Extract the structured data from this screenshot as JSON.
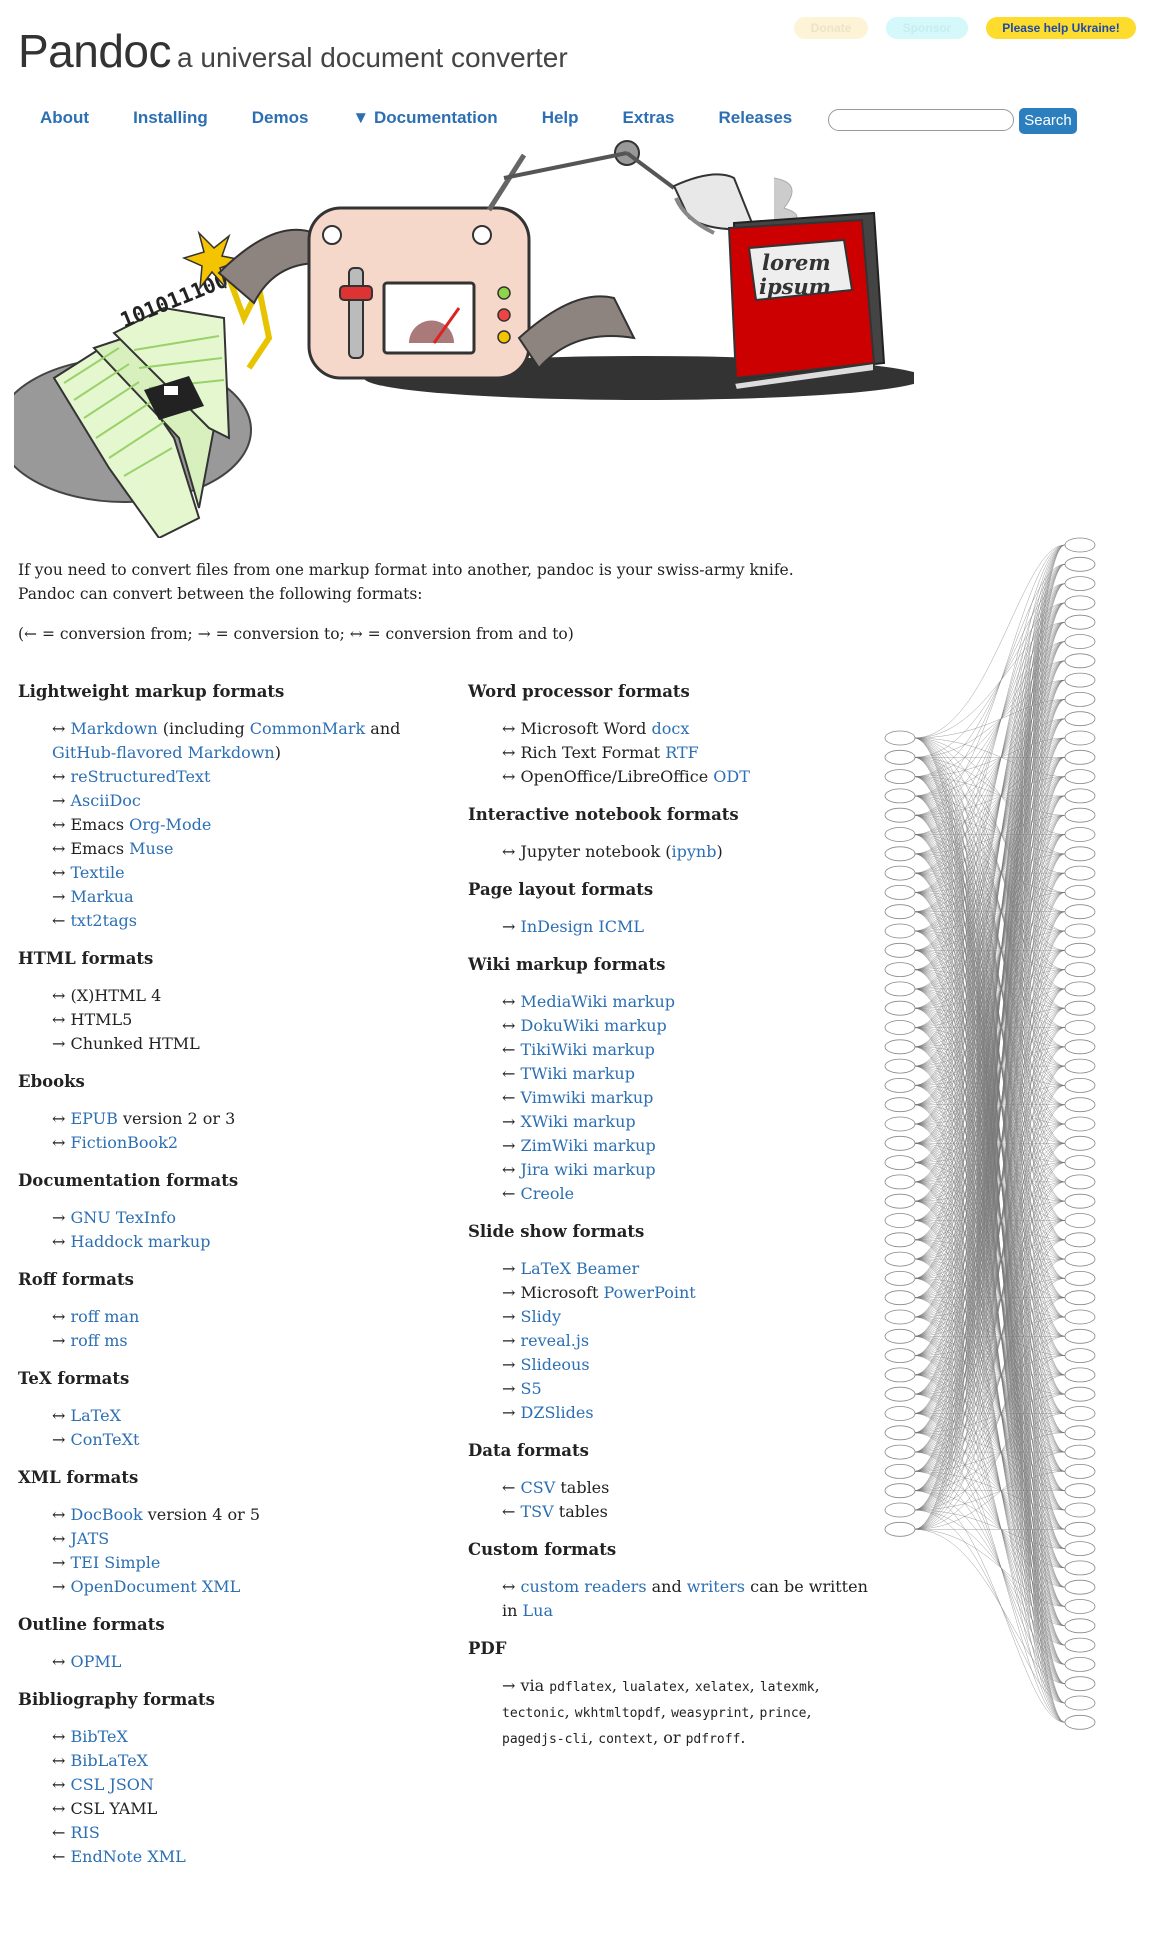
{
  "header": {
    "brand": "Pandoc",
    "tagline": "a universal document converter",
    "donate": "Donate",
    "sponsor": "Sponsor",
    "ukraine": "Please help Ukraine!"
  },
  "nav": [
    {
      "label": "About"
    },
    {
      "label": "Installing"
    },
    {
      "label": "Demos"
    },
    {
      "label": "▼ Documentation"
    },
    {
      "label": "Help"
    },
    {
      "label": "Extras"
    },
    {
      "label": "Releases"
    }
  ],
  "search": {
    "button": "Search"
  },
  "hero": {
    "binary": "10101110001",
    "book_line1": "lorem",
    "book_line2": "ipsum"
  },
  "intro": {
    "p1": "If you need to convert files from one markup format into another, pandoc is your swiss-army knife. Pandoc can convert between the following formats:",
    "p2": "(← = conversion from; → = conversion to; ↔ = conversion from and to)"
  },
  "colors": {
    "link": "#2c6fb3",
    "ukraine_bg": "#fddc2e",
    "search_bg": "#2c7fbf"
  },
  "col1": [
    {
      "title": "Lightweight markup formats",
      "items": [
        {
          "parts": [
            {
              "t": "↔ "
            },
            {
              "t": "Markdown",
              "link": true
            },
            {
              "t": " (including "
            },
            {
              "t": "CommonMark",
              "link": true
            },
            {
              "t": " and "
            },
            {
              "t": "GitHub-flavored Markdown",
              "link": true
            },
            {
              "t": ")"
            }
          ]
        },
        {
          "parts": [
            {
              "t": "↔ "
            },
            {
              "t": "reStructuredText",
              "link": true
            }
          ]
        },
        {
          "parts": [
            {
              "t": "→ "
            },
            {
              "t": "AsciiDoc",
              "link": true
            }
          ]
        },
        {
          "parts": [
            {
              "t": "↔ Emacs "
            },
            {
              "t": "Org-Mode",
              "link": true
            }
          ]
        },
        {
          "parts": [
            {
              "t": "↔ Emacs "
            },
            {
              "t": "Muse",
              "link": true
            }
          ]
        },
        {
          "parts": [
            {
              "t": "↔ "
            },
            {
              "t": "Textile",
              "link": true
            }
          ]
        },
        {
          "parts": [
            {
              "t": "→ "
            },
            {
              "t": "Markua",
              "link": true
            }
          ]
        },
        {
          "parts": [
            {
              "t": "← "
            },
            {
              "t": "txt2tags",
              "link": true
            }
          ]
        }
      ]
    },
    {
      "title": "HTML formats",
      "items": [
        {
          "parts": [
            {
              "t": "↔ (X)HTML 4"
            }
          ]
        },
        {
          "parts": [
            {
              "t": "↔ HTML5"
            }
          ]
        },
        {
          "parts": [
            {
              "t": "→ Chunked HTML"
            }
          ]
        }
      ]
    },
    {
      "title": "Ebooks",
      "items": [
        {
          "parts": [
            {
              "t": "↔ "
            },
            {
              "t": "EPUB",
              "link": true
            },
            {
              "t": " version 2 or 3"
            }
          ]
        },
        {
          "parts": [
            {
              "t": "↔ "
            },
            {
              "t": "FictionBook2",
              "link": true
            }
          ]
        }
      ]
    },
    {
      "title": "Documentation formats",
      "items": [
        {
          "parts": [
            {
              "t": "→ "
            },
            {
              "t": "GNU TexInfo",
              "link": true
            }
          ]
        },
        {
          "parts": [
            {
              "t": "↔ "
            },
            {
              "t": "Haddock markup",
              "link": true
            }
          ]
        }
      ]
    },
    {
      "title": "Roff formats",
      "items": [
        {
          "parts": [
            {
              "t": "↔ "
            },
            {
              "t": "roff man",
              "link": true
            }
          ]
        },
        {
          "parts": [
            {
              "t": "→ "
            },
            {
              "t": "roff ms",
              "link": true
            }
          ]
        }
      ]
    },
    {
      "title": "TeX formats",
      "items": [
        {
          "parts": [
            {
              "t": "↔ "
            },
            {
              "t": "LaTeX",
              "link": true
            }
          ]
        },
        {
          "parts": [
            {
              "t": "→ "
            },
            {
              "t": "ConTeXt",
              "link": true
            }
          ]
        }
      ]
    },
    {
      "title": "XML formats",
      "items": [
        {
          "parts": [
            {
              "t": "↔ "
            },
            {
              "t": "DocBook",
              "link": true
            },
            {
              "t": " version 4 or 5"
            }
          ]
        },
        {
          "parts": [
            {
              "t": "↔ "
            },
            {
              "t": "JATS",
              "link": true
            }
          ]
        },
        {
          "parts": [
            {
              "t": "→ "
            },
            {
              "t": "TEI Simple",
              "link": true
            }
          ]
        },
        {
          "parts": [
            {
              "t": "→ "
            },
            {
              "t": "OpenDocument XML",
              "link": true
            }
          ]
        }
      ]
    },
    {
      "title": "Outline formats",
      "items": [
        {
          "parts": [
            {
              "t": "↔ "
            },
            {
              "t": "OPML",
              "link": true
            }
          ]
        }
      ]
    },
    {
      "title": "Bibliography formats",
      "items": [
        {
          "parts": [
            {
              "t": "↔ "
            },
            {
              "t": "BibTeX",
              "link": true
            }
          ]
        },
        {
          "parts": [
            {
              "t": "↔ "
            },
            {
              "t": "BibLaTeX",
              "link": true
            }
          ]
        },
        {
          "parts": [
            {
              "t": "↔ "
            },
            {
              "t": "CSL JSON",
              "link": true
            }
          ]
        },
        {
          "parts": [
            {
              "t": "↔ CSL YAML"
            }
          ]
        },
        {
          "parts": [
            {
              "t": "← "
            },
            {
              "t": "RIS",
              "link": true
            }
          ]
        },
        {
          "parts": [
            {
              "t": "← "
            },
            {
              "t": "EndNote XML",
              "link": true
            }
          ]
        }
      ]
    }
  ],
  "col2": [
    {
      "title": "Word processor formats",
      "items": [
        {
          "parts": [
            {
              "t": "↔ Microsoft Word "
            },
            {
              "t": "docx",
              "link": true
            }
          ]
        },
        {
          "parts": [
            {
              "t": "↔ Rich Text Format "
            },
            {
              "t": "RTF",
              "link": true
            }
          ]
        },
        {
          "parts": [
            {
              "t": "↔ OpenOffice/LibreOffice "
            },
            {
              "t": "ODT",
              "link": true
            }
          ]
        }
      ]
    },
    {
      "title": "Interactive notebook formats",
      "items": [
        {
          "parts": [
            {
              "t": "↔ Jupyter notebook ("
            },
            {
              "t": "ipynb",
              "link": true
            },
            {
              "t": ")"
            }
          ]
        }
      ]
    },
    {
      "title": "Page layout formats",
      "items": [
        {
          "parts": [
            {
              "t": "→ "
            },
            {
              "t": "InDesign ICML",
              "link": true
            }
          ]
        }
      ]
    },
    {
      "title": "Wiki markup formats",
      "items": [
        {
          "parts": [
            {
              "t": "↔ "
            },
            {
              "t": "MediaWiki markup",
              "link": true
            }
          ]
        },
        {
          "parts": [
            {
              "t": "↔ "
            },
            {
              "t": "DokuWiki markup",
              "link": true
            }
          ]
        },
        {
          "parts": [
            {
              "t": "← "
            },
            {
              "t": "TikiWiki markup",
              "link": true
            }
          ]
        },
        {
          "parts": [
            {
              "t": "← "
            },
            {
              "t": "TWiki markup",
              "link": true
            }
          ]
        },
        {
          "parts": [
            {
              "t": "← "
            },
            {
              "t": "Vimwiki markup",
              "link": true
            }
          ]
        },
        {
          "parts": [
            {
              "t": "→ "
            },
            {
              "t": "XWiki markup",
              "link": true
            }
          ]
        },
        {
          "parts": [
            {
              "t": "→ "
            },
            {
              "t": "ZimWiki markup",
              "link": true
            }
          ]
        },
        {
          "parts": [
            {
              "t": "↔ "
            },
            {
              "t": "Jira wiki markup",
              "link": true
            }
          ]
        },
        {
          "parts": [
            {
              "t": "← "
            },
            {
              "t": "Creole",
              "link": true
            }
          ]
        }
      ]
    },
    {
      "title": "Slide show formats",
      "items": [
        {
          "parts": [
            {
              "t": "→ "
            },
            {
              "t": "LaTeX Beamer",
              "link": true
            }
          ]
        },
        {
          "parts": [
            {
              "t": "→ Microsoft "
            },
            {
              "t": "PowerPoint",
              "link": true
            }
          ]
        },
        {
          "parts": [
            {
              "t": "→ "
            },
            {
              "t": "Slidy",
              "link": true
            }
          ]
        },
        {
          "parts": [
            {
              "t": "→ "
            },
            {
              "t": "reveal.js",
              "link": true
            }
          ]
        },
        {
          "parts": [
            {
              "t": "→ "
            },
            {
              "t": "Slideous",
              "link": true
            }
          ]
        },
        {
          "parts": [
            {
              "t": "→ "
            },
            {
              "t": "S5",
              "link": true
            }
          ]
        },
        {
          "parts": [
            {
              "t": "→ "
            },
            {
              "t": "DZSlides",
              "link": true
            }
          ]
        }
      ]
    },
    {
      "title": "Data formats",
      "items": [
        {
          "parts": [
            {
              "t": "← "
            },
            {
              "t": "CSV",
              "link": true
            },
            {
              "t": " tables"
            }
          ]
        },
        {
          "parts": [
            {
              "t": "← "
            },
            {
              "t": "TSV",
              "link": true
            },
            {
              "t": " tables"
            }
          ]
        }
      ]
    },
    {
      "title": "Custom formats",
      "items": [
        {
          "parts": [
            {
              "t": "↔ "
            },
            {
              "t": "custom readers",
              "link": true
            },
            {
              "t": " and "
            },
            {
              "t": "writers",
              "link": true
            },
            {
              "t": " can be written in "
            },
            {
              "t": "Lua",
              "link": true
            }
          ]
        }
      ]
    },
    {
      "title": "PDF",
      "items": [
        {
          "parts": [
            {
              "t": "→ via "
            },
            {
              "t": "pdflatex",
              "code": true
            },
            {
              "t": ", "
            },
            {
              "t": "lualatex",
              "code": true
            },
            {
              "t": ", "
            },
            {
              "t": "xelatex",
              "code": true
            },
            {
              "t": ", "
            },
            {
              "t": "latexmk",
              "code": true
            },
            {
              "t": ", "
            },
            {
              "t": "tectonic",
              "code": true
            },
            {
              "t": ", "
            },
            {
              "t": "wkhtmltopdf",
              "code": true
            },
            {
              "t": ", "
            },
            {
              "t": "weasyprint",
              "code": true
            },
            {
              "t": ", "
            },
            {
              "t": "prince",
              "code": true
            },
            {
              "t": ", "
            },
            {
              "t": "pagedjs-cli",
              "code": true
            },
            {
              "t": ", "
            },
            {
              "t": "context",
              "code": true
            },
            {
              "t": ", or "
            },
            {
              "t": "pdfroff",
              "code": true
            },
            {
              "t": "."
            }
          ]
        }
      ]
    }
  ]
}
